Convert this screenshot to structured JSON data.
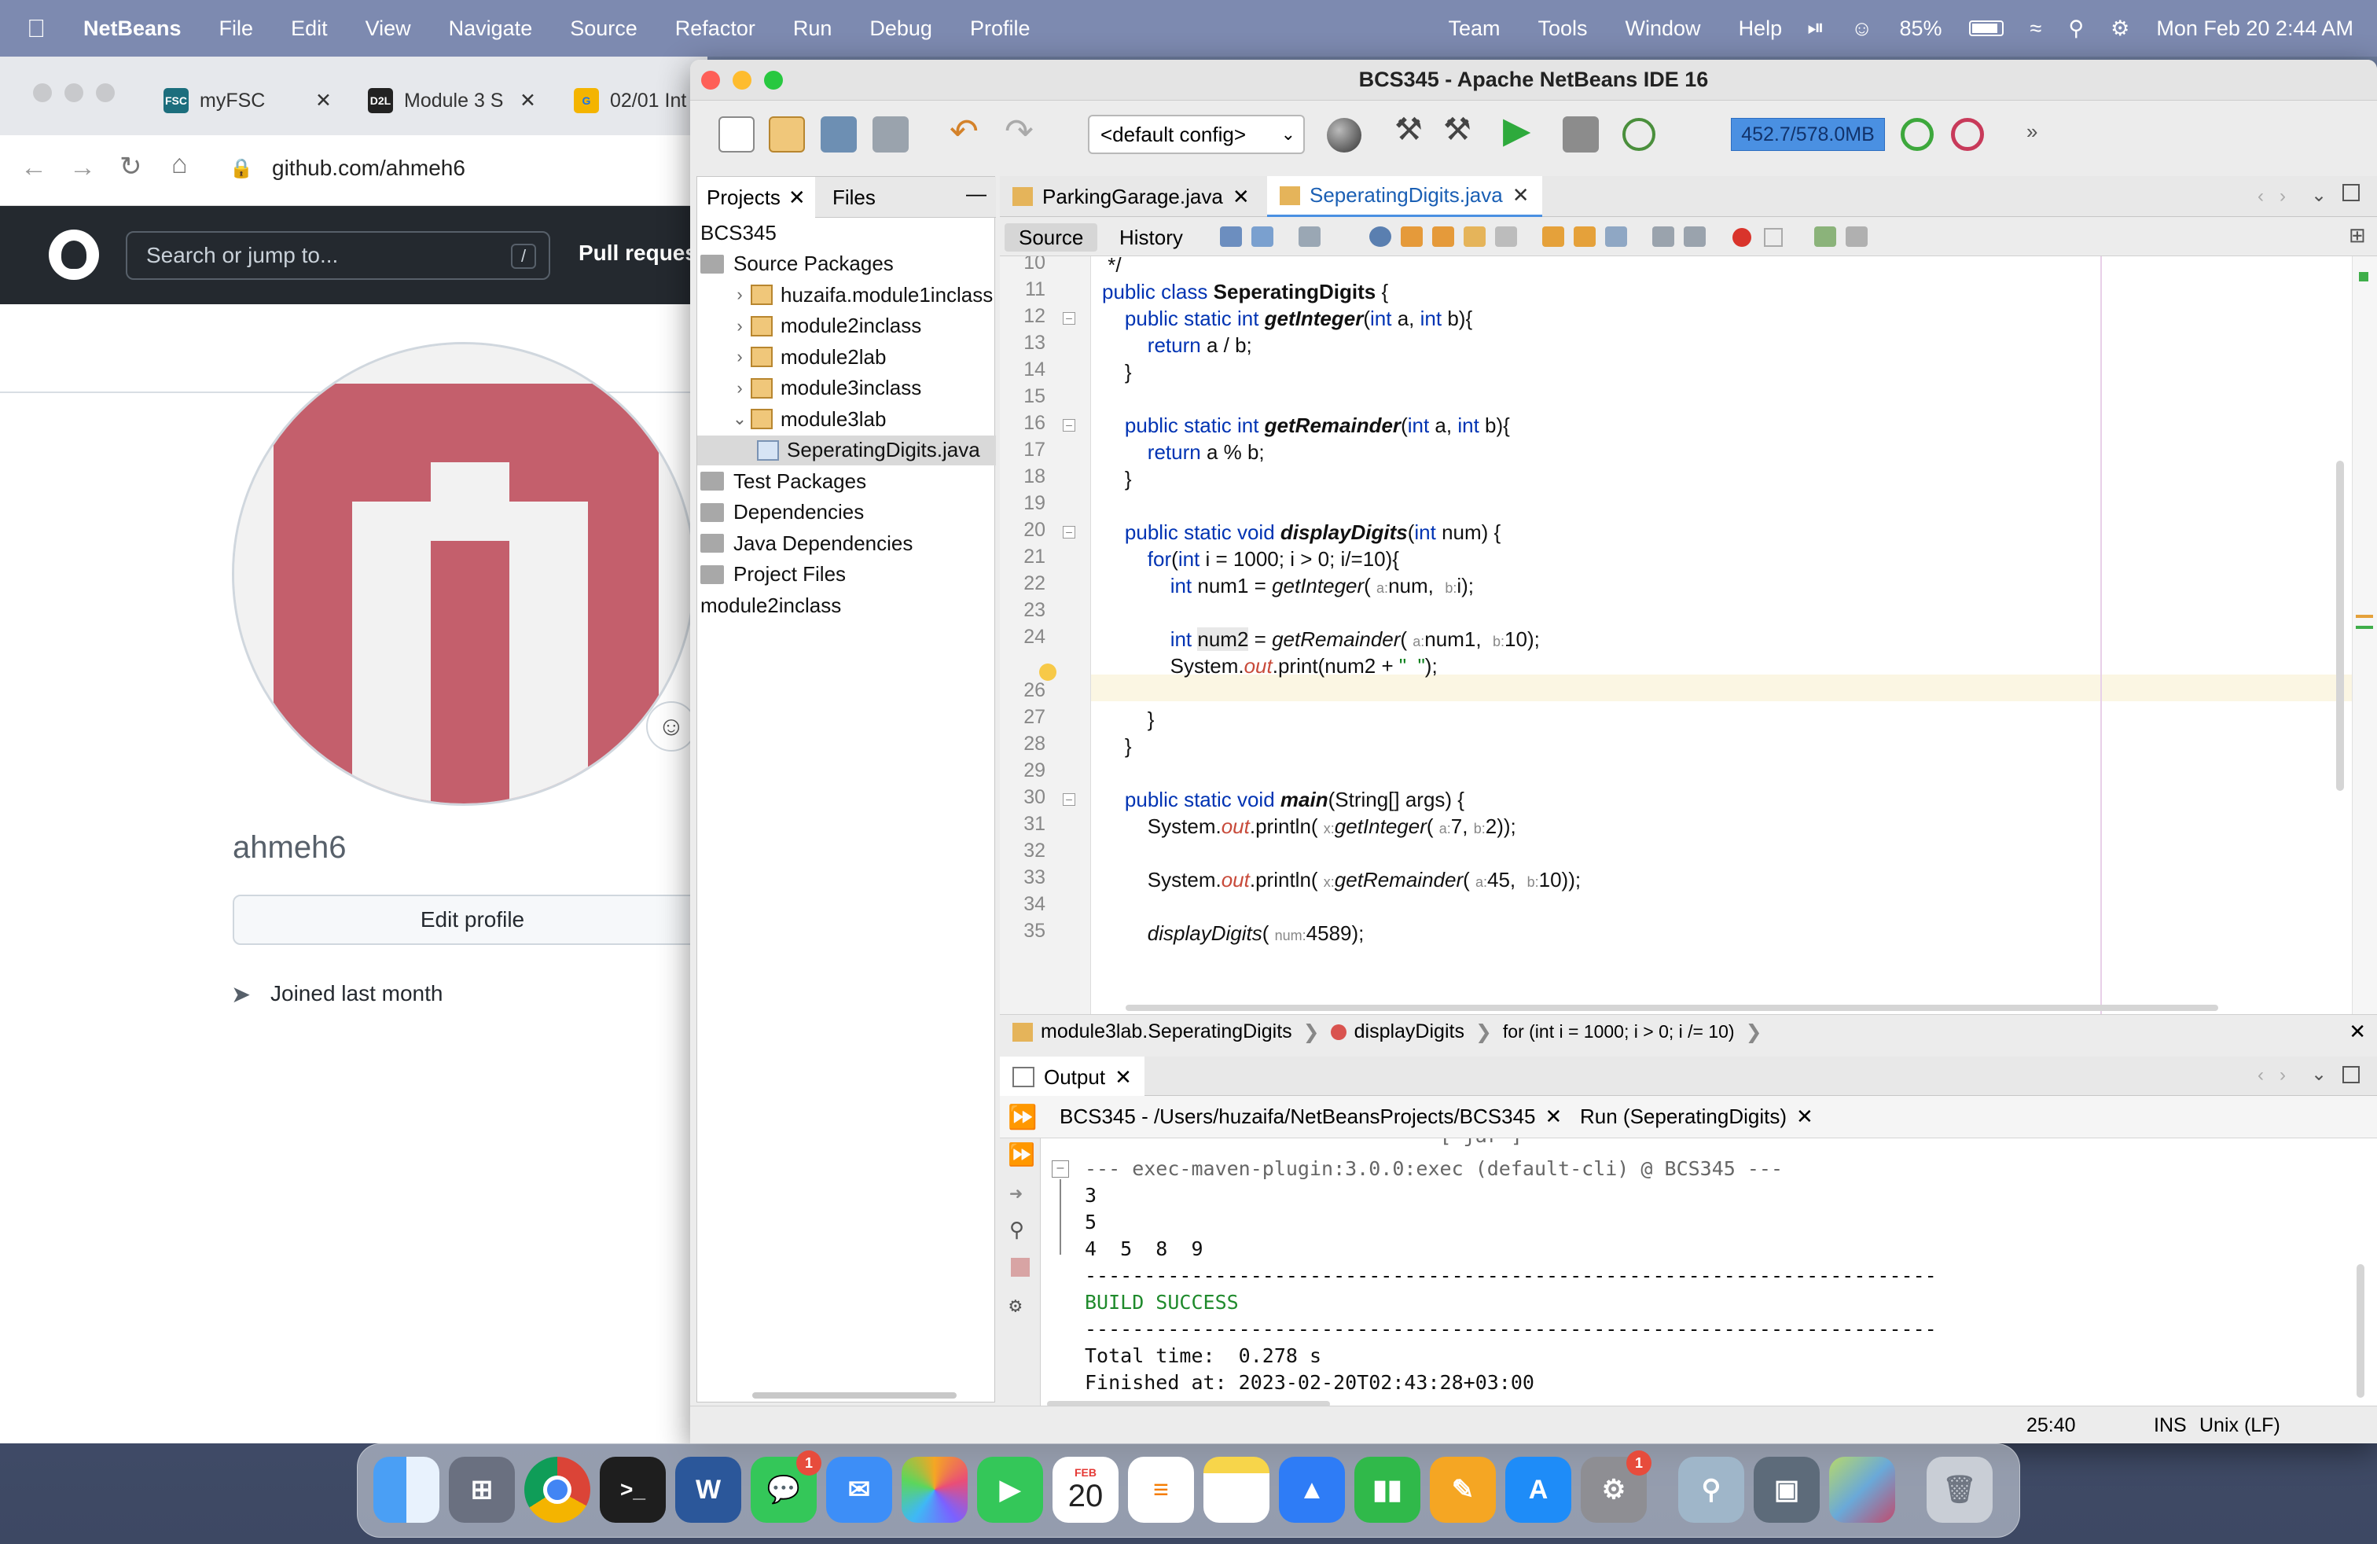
{
  "menubar": {
    "apple": "",
    "app": "NetBeans",
    "items": [
      "File",
      "Edit",
      "View",
      "Navigate",
      "Source",
      "Refactor",
      "Run",
      "Debug",
      "Profile",
      "Team",
      "Tools",
      "Window",
      "Help"
    ],
    "battery": "85%",
    "clock": "Mon Feb 20  2:44 AM"
  },
  "browser": {
    "tabs": [
      {
        "favicon": "FSC",
        "label": "myFSC"
      },
      {
        "favicon": "D2L",
        "label": "Module 3 S"
      },
      {
        "favicon": "G",
        "label": "02/01 Int"
      }
    ],
    "address": "github.com/ahmeh6",
    "search_placeholder": "Search or jump to...",
    "search_key": "/",
    "pull_requests": "Pull reques",
    "username": "ahmeh6",
    "edit_profile": "Edit profile",
    "joined": "Joined last month"
  },
  "netbeans": {
    "title": "BCS345 - Apache NetBeans IDE 16",
    "config": "<default config>",
    "memory": "452.7/578.0MB",
    "panel_tabs": [
      "Projects",
      "Files"
    ],
    "tree": [
      {
        "label": "BCS345",
        "depth": 0,
        "type": "root"
      },
      {
        "label": "Source Packages",
        "depth": 0,
        "type": "folder"
      },
      {
        "label": "huzaifa.module1inclass",
        "depth": 1,
        "type": "pkg"
      },
      {
        "label": "module2inclass",
        "depth": 1,
        "type": "pkg"
      },
      {
        "label": "module2lab",
        "depth": 1,
        "type": "pkg"
      },
      {
        "label": "module3inclass",
        "depth": 1,
        "type": "pkg"
      },
      {
        "label": "module3lab",
        "depth": 1,
        "type": "pkg-open"
      },
      {
        "label": "SeperatingDigits.java",
        "depth": 2,
        "type": "file"
      },
      {
        "label": "Test Packages",
        "depth": 0,
        "type": "folder"
      },
      {
        "label": "Dependencies",
        "depth": 0,
        "type": "folder"
      },
      {
        "label": "Java Dependencies",
        "depth": 0,
        "type": "folder"
      },
      {
        "label": "Project Files",
        "depth": 0,
        "type": "folder"
      },
      {
        "label": "module2inclass",
        "depth": 0,
        "type": "root"
      }
    ],
    "editor_tabs": [
      "ParkingGarage.java",
      "SeperatingDigits.java"
    ],
    "editor_buttons": [
      "Source",
      "History"
    ],
    "line_numbers": [
      "10",
      "11",
      "12",
      "13",
      "14",
      "15",
      "16",
      "17",
      "18",
      "19",
      "20",
      "21",
      "22",
      "23",
      "24",
      "",
      "26",
      "27",
      "28",
      "29",
      "30",
      "31",
      "32",
      "33",
      "34",
      "35"
    ],
    "breadcrumbs": [
      "module3lab.SeperatingDigits",
      "displayDigits",
      "for (int i = 1000; i > 0; i /= 10)"
    ],
    "output_title": "Output",
    "output_tabs": [
      "BCS345 - /Users/huzaifa/NetBeansProjects/BCS345",
      "Run (SeperatingDigits)"
    ],
    "output_lines": [
      "------------------------------[ jar ]-----------------------------------",
      "--- exec-maven-plugin:3.0.0:exec (default-cli) @ BCS345 ---",
      "3",
      "5",
      "4  5  8  9",
      "------------------------------------------------------------------------",
      "BUILD SUCCESS",
      "------------------------------------------------------------------------",
      "Total time:  0.278 s",
      "Finished at: 2023-02-20T02:43:28+03:00"
    ],
    "status_position": "25:40",
    "status_mode": "INS",
    "status_eol": "Unix (LF)"
  },
  "dock": {
    "items": [
      "Finder",
      "Launchpad",
      "Chrome",
      "Terminal",
      "Word",
      "Messages",
      "Mail",
      "Photos",
      "FaceTime",
      "Calendar",
      "Reminders",
      "Notes",
      "Keynote",
      "Numbers",
      "Pages",
      "App Store",
      "System Settings",
      "Preview",
      "Image Capture",
      "NetBeans",
      "Trash"
    ],
    "calendar_month": "FEB",
    "calendar_day": "20",
    "messages_badge": "1",
    "settings_badge": "1"
  }
}
